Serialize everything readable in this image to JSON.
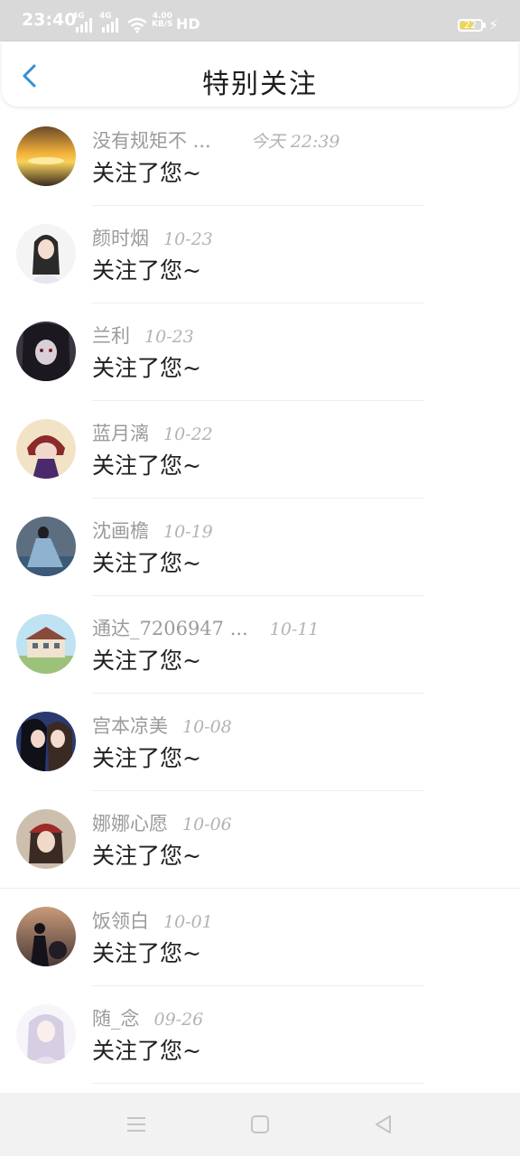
{
  "status_bar": {
    "time": "23:40",
    "signal_1_label": "4G",
    "signal_2_label": "4G",
    "net_speed_value": "4.00",
    "net_speed_unit": "KB/S",
    "hd_label": "HD",
    "battery_level": "22",
    "icons": [
      "signal-icon",
      "signal-icon",
      "wifi-icon",
      "battery-icon",
      "charging-bolt-icon"
    ]
  },
  "header": {
    "title": "特别关注",
    "back_icon": "chevron-left-icon",
    "accent_color": "#2f8fd8"
  },
  "notifications": [
    {
      "name": "没有规矩不 ...",
      "date": "今天 22:39",
      "message": "关注了您~"
    },
    {
      "name": "颜时烟",
      "date": "10-23",
      "message": "关注了您~"
    },
    {
      "name": "兰利",
      "date": "10-23",
      "message": "关注了您~"
    },
    {
      "name": "蓝月漓",
      "date": "10-22",
      "message": "关注了您~"
    },
    {
      "name": "沈画檐",
      "date": "10-19",
      "message": "关注了您~"
    },
    {
      "name": "通达_7206947 ...",
      "date": "10-11",
      "message": "关注了您~"
    },
    {
      "name": "宫本凉美",
      "date": "10-08",
      "message": "关注了您~"
    },
    {
      "name": "娜娜心愿",
      "date": "10-06",
      "message": "关注了您~"
    },
    {
      "name": "饭领白",
      "date": "10-01",
      "message": "关注了您~"
    },
    {
      "name": "随_念",
      "date": "09-26",
      "message": "关注了您~"
    }
  ],
  "nav_bar": {
    "icons": [
      "menu-icon",
      "home-square-icon",
      "back-triangle-icon"
    ]
  }
}
